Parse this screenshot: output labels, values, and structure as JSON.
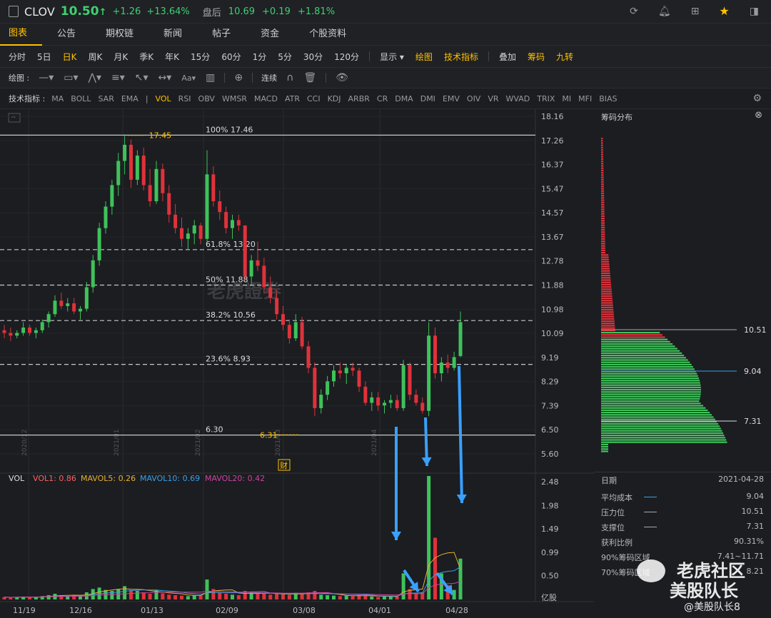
{
  "header": {
    "ticker": "CLOV",
    "price": "10.50",
    "arrow": "↑",
    "change": "+1.26",
    "change_pct": "+13.64%",
    "ah_label": "盘后",
    "ah_price": "10.69",
    "ah_change": "+0.19",
    "ah_change_pct": "+1.81%"
  },
  "tabs": [
    "图表",
    "公告",
    "期权链",
    "新闻",
    "帖子",
    "资金",
    "个股资料"
  ],
  "periods": [
    "分时",
    "5日",
    "日K",
    "周K",
    "月K",
    "季K",
    "年K",
    "15分",
    "60分",
    "1分",
    "5分",
    "30分",
    "120分"
  ],
  "period_tools": {
    "display": "显示",
    "draw": "绘图",
    "tech": "技术指标",
    "overlay": "叠加",
    "chips": "筹码",
    "nine": "九转"
  },
  "draw_label": "绘图 :",
  "draw_connect": "连续",
  "indicator_label": "技术指标 :",
  "indicators": [
    "MA",
    "BOLL",
    "SAR",
    "EMA",
    "VOL",
    "RSI",
    "OBV",
    "WMSR",
    "MACD",
    "ATR",
    "CCI",
    "KDJ",
    "ARBR",
    "CR",
    "DMA",
    "DMI",
    "EMV",
    "OIV",
    "VR",
    "WVAD",
    "TRIX",
    "MI",
    "MFI",
    "BIAS"
  ],
  "price_axis": [
    "18.16",
    "17.26",
    "16.37",
    "15.47",
    "14.57",
    "13.67",
    "12.78",
    "11.88",
    "10.98",
    "10.09",
    "9.19",
    "8.29",
    "7.39",
    "6.50",
    "5.60"
  ],
  "vol_axis": [
    "2.48",
    "1.98",
    "1.49",
    "0.99",
    "0.50",
    "亿股"
  ],
  "date_axis": [
    "11/19",
    "12/16",
    "01/13",
    "02/09",
    "03/08",
    "04/01",
    "04/28"
  ],
  "year_marks": [
    "2020/12",
    "2021/01",
    "2021/02",
    "2021/03",
    "2021/04"
  ],
  "fib": [
    {
      "label": "100% 17.46"
    },
    {
      "label": "61.8% 13.20"
    },
    {
      "label": "50% 11.88"
    },
    {
      "label": "38.2% 10.56"
    },
    {
      "label": "23.6% 8.93"
    },
    {
      "label": "6.30"
    }
  ],
  "high_label": "17.45",
  "low_label": "6.31",
  "earnings_marker": "财",
  "watermark": "老虎證券",
  "vol_legend": {
    "vol": "VOL",
    "vol1": "VOL1: 0.86",
    "mavol5": "MAVOL5: 0.26",
    "mavol10": "MAVOL10: 0.69",
    "mavol20": "MAVOL20: 0.42"
  },
  "colors": {
    "up": "#e0323a",
    "down": "#3fc25a",
    "accent": "#ffc000",
    "fib": "#c8c8c8",
    "mavol5": "#e8b030",
    "mavol10": "#3aa0e8",
    "mavol20": "#d040a0"
  },
  "chips": {
    "title": "筹码分布",
    "markers": [
      "10.51",
      "9.04",
      "7.31"
    ],
    "date_label": "日期",
    "date": "2021-04-28",
    "rows": [
      {
        "k": "平均成本",
        "v": "9.04"
      },
      {
        "k": "压力位",
        "v": "10.51"
      },
      {
        "k": "支撑位",
        "v": "7.31"
      },
      {
        "k": "获利比例",
        "v": "90.31%"
      },
      {
        "k": "90%筹码区域",
        "v": "7.41~11.71"
      },
      {
        "k": "70%筹码区域",
        "v": "8.21"
      }
    ]
  },
  "overlay": {
    "brand": "老虎社区",
    "team": "美股队长",
    "handle": "@美股队长8"
  },
  "chart_data": {
    "type": "candlestick",
    "ylim": [
      5.6,
      18.16
    ],
    "vol_ylim": [
      0,
      2.48
    ],
    "candles": [
      [
        10.2,
        10.4,
        9.9,
        10.1
      ],
      [
        10.1,
        10.3,
        9.8,
        10.0
      ],
      [
        10.0,
        10.2,
        9.9,
        10.1
      ],
      [
        10.1,
        10.5,
        10.0,
        10.3
      ],
      [
        10.3,
        10.4,
        10.0,
        10.1
      ],
      [
        10.1,
        10.3,
        9.9,
        10.2
      ],
      [
        10.2,
        10.6,
        10.1,
        10.5
      ],
      [
        10.5,
        10.9,
        10.3,
        10.8
      ],
      [
        10.8,
        11.5,
        10.7,
        11.3
      ],
      [
        11.3,
        11.6,
        11.0,
        11.1
      ],
      [
        11.1,
        11.4,
        10.9,
        11.2
      ],
      [
        11.2,
        11.4,
        10.8,
        10.9
      ],
      [
        10.9,
        11.1,
        10.6,
        11.0
      ],
      [
        11.0,
        12.0,
        10.9,
        11.8
      ],
      [
        11.8,
        13.0,
        11.6,
        12.8
      ],
      [
        12.8,
        14.2,
        12.6,
        14.0
      ],
      [
        14.0,
        15.0,
        13.8,
        14.8
      ],
      [
        14.8,
        15.8,
        14.5,
        15.6
      ],
      [
        15.6,
        16.8,
        15.2,
        16.5
      ],
      [
        16.5,
        17.45,
        16.0,
        17.1
      ],
      [
        17.1,
        17.3,
        15.5,
        15.8
      ],
      [
        15.8,
        16.9,
        15.6,
        16.7
      ],
      [
        16.7,
        17.0,
        15.4,
        15.6
      ],
      [
        15.6,
        16.2,
        14.8,
        15.0
      ],
      [
        15.0,
        16.5,
        14.9,
        16.2
      ],
      [
        16.2,
        16.4,
        15.0,
        15.3
      ],
      [
        15.3,
        15.6,
        14.2,
        14.5
      ],
      [
        14.5,
        14.9,
        13.8,
        14.0
      ],
      [
        14.0,
        14.4,
        13.3,
        13.6
      ],
      [
        13.6,
        14.0,
        13.2,
        13.8
      ],
      [
        13.8,
        14.3,
        13.4,
        14.1
      ],
      [
        14.1,
        14.2,
        13.4,
        13.6
      ],
      [
        13.6,
        16.9,
        13.5,
        16.0
      ],
      [
        16.0,
        16.3,
        14.8,
        15.0
      ],
      [
        15.0,
        15.4,
        14.3,
        14.6
      ],
      [
        14.6,
        14.8,
        13.8,
        14.0
      ],
      [
        14.0,
        14.5,
        13.6,
        14.3
      ],
      [
        14.3,
        14.5,
        13.9,
        14.1
      ],
      [
        14.1,
        13.3,
        12.0,
        12.2
      ],
      [
        12.2,
        13.0,
        11.9,
        12.8
      ],
      [
        12.8,
        13.5,
        12.4,
        12.6
      ],
      [
        12.6,
        12.9,
        11.6,
        11.8
      ],
      [
        11.8,
        12.2,
        11.2,
        11.4
      ],
      [
        11.4,
        11.7,
        10.6,
        10.8
      ],
      [
        10.8,
        11.1,
        10.2,
        10.4
      ],
      [
        10.4,
        10.6,
        9.7,
        9.9
      ],
      [
        9.9,
        10.8,
        9.8,
        10.5
      ],
      [
        10.5,
        10.7,
        9.5,
        9.6
      ],
      [
        9.6,
        9.8,
        8.6,
        8.8
      ],
      [
        8.8,
        9.0,
        7.0,
        7.3
      ],
      [
        7.3,
        8.0,
        7.1,
        7.8
      ],
      [
        7.8,
        8.5,
        7.6,
        8.3
      ],
      [
        8.3,
        8.9,
        8.1,
        8.7
      ],
      [
        8.7,
        9.0,
        8.4,
        8.6
      ],
      [
        8.6,
        8.9,
        8.2,
        8.8
      ],
      [
        8.8,
        9.0,
        8.5,
        8.7
      ],
      [
        8.7,
        8.8,
        7.9,
        8.1
      ],
      [
        8.1,
        8.3,
        7.4,
        7.5
      ],
      [
        7.5,
        7.9,
        7.2,
        7.7
      ],
      [
        7.7,
        7.9,
        7.2,
        7.4
      ],
      [
        7.4,
        7.6,
        7.1,
        7.5
      ],
      [
        7.5,
        7.8,
        7.3,
        7.6
      ],
      [
        7.6,
        7.8,
        7.2,
        7.3
      ],
      [
        7.3,
        9.1,
        7.2,
        8.9
      ],
      [
        8.9,
        9.0,
        7.6,
        7.8
      ],
      [
        7.8,
        8.0,
        7.4,
        7.5
      ],
      [
        7.5,
        7.7,
        7.1,
        7.2
      ],
      [
        7.2,
        10.5,
        7.0,
        10.0
      ],
      [
        10.0,
        10.3,
        8.4,
        8.6
      ],
      [
        8.6,
        9.2,
        8.3,
        9.0
      ],
      [
        9.0,
        9.3,
        8.6,
        8.8
      ],
      [
        8.8,
        9.4,
        8.7,
        9.2
      ],
      [
        9.24,
        10.9,
        9.2,
        10.5
      ]
    ],
    "volumes": [
      0.05,
      0.04,
      0.05,
      0.06,
      0.04,
      0.05,
      0.07,
      0.09,
      0.12,
      0.08,
      0.07,
      0.09,
      0.08,
      0.15,
      0.22,
      0.25,
      0.2,
      0.18,
      0.22,
      0.28,
      0.2,
      0.18,
      0.15,
      0.12,
      0.2,
      0.13,
      0.1,
      0.09,
      0.08,
      0.07,
      0.09,
      0.08,
      0.42,
      0.22,
      0.15,
      0.12,
      0.1,
      0.09,
      0.18,
      0.14,
      0.12,
      0.13,
      0.1,
      0.12,
      0.11,
      0.1,
      0.14,
      0.12,
      0.15,
      0.18,
      0.1,
      0.09,
      0.08,
      0.07,
      0.08,
      0.07,
      0.09,
      0.08,
      0.06,
      0.05,
      0.06,
      0.07,
      0.06,
      0.55,
      0.22,
      0.12,
      0.15,
      2.6,
      1.3,
      0.55,
      0.3,
      0.2,
      0.86
    ]
  }
}
